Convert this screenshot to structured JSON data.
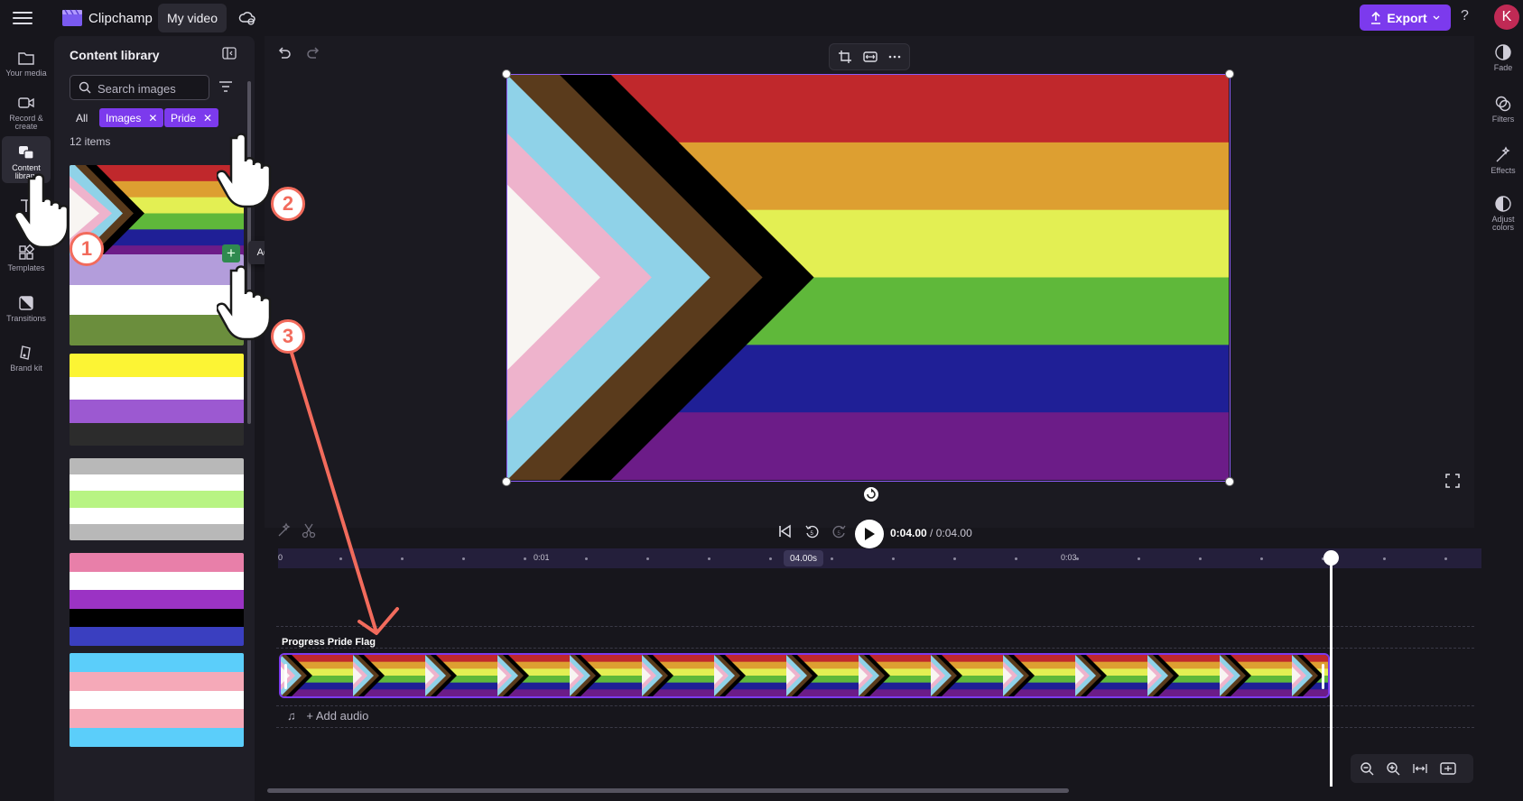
{
  "app": {
    "name": "Clipchamp",
    "project_title": "My video",
    "export_label": "Export",
    "help_label": "?",
    "avatar_initial": "K",
    "accent": "#7c3aed"
  },
  "left_rail": [
    {
      "label": "Your media",
      "icon": "folder-icon"
    },
    {
      "label": "Record & create",
      "icon": "camera-icon"
    },
    {
      "label": "Content library",
      "icon": "content-library-icon",
      "active": true
    },
    {
      "label": "Text",
      "icon": "text-icon"
    },
    {
      "label": "Templates",
      "icon": "templates-icon"
    },
    {
      "label": "Transitions",
      "icon": "transitions-icon"
    },
    {
      "label": "Brand kit",
      "icon": "brand-kit-icon"
    }
  ],
  "library": {
    "title": "Content library",
    "search_placeholder": "Search images",
    "chip_all": "All",
    "chips": [
      "Images",
      "Pride"
    ],
    "items_count": "12 items",
    "tooltip": "Add to timeline",
    "add_symbol": "+",
    "thumbnails": [
      {
        "name": "progress-pride",
        "colors": [
          "#c0282c",
          "#dd9f31",
          "#e3ef53",
          "#5fb83a",
          "#1f1f96",
          "#6c1c88"
        ]
      },
      {
        "name": "genderqueer",
        "colors": [
          "#b39ddb",
          "#ffffff",
          "#6b8e3d"
        ]
      },
      {
        "name": "nonbinary",
        "colors": [
          "#fcf434",
          "#ffffff",
          "#9c59d1",
          "#2c2c2c"
        ]
      },
      {
        "name": "agender",
        "colors": [
          "#b8b8b8",
          "#ffffff",
          "#b8f483",
          "#ffffff",
          "#b8b8b8"
        ]
      },
      {
        "name": "asexual-variant",
        "colors": [
          "#e87fa9",
          "#ffffff",
          "#9b33c4",
          "#000000",
          "#3a3fc0"
        ]
      },
      {
        "name": "transgender",
        "colors": [
          "#5bcefa",
          "#f5a9b8",
          "#ffffff",
          "#f5a9b8",
          "#5bcefa"
        ]
      }
    ]
  },
  "preview": {
    "flag_stripes": [
      "#c0282c",
      "#dd9f31",
      "#e3ef53",
      "#5fb83a",
      "#1f1f96",
      "#6c1c88"
    ],
    "chevrons": [
      "#000000",
      "#5a3b1c",
      "#8fd2e8",
      "#eeb3cc",
      "#f8f5f2"
    ]
  },
  "playback": {
    "current": "0:04.00",
    "separator": " / ",
    "total": "0:04.00"
  },
  "timeline": {
    "ticks": [
      "0",
      "0:01",
      "0:03"
    ],
    "timecode_bubble": "04.00s",
    "clip_label": "Progress Pride Flag",
    "audio_label": "+ Add audio"
  },
  "right_rail": [
    {
      "label": "Fade",
      "icon": "fade-icon"
    },
    {
      "label": "Filters",
      "icon": "filters-icon"
    },
    {
      "label": "Effects",
      "icon": "effects-icon"
    },
    {
      "label": "Adjust colors",
      "icon": "adjust-colors-icon"
    }
  ],
  "annotations": {
    "steps": [
      "1",
      "2",
      "3"
    ],
    "color": "#f26b5c"
  }
}
